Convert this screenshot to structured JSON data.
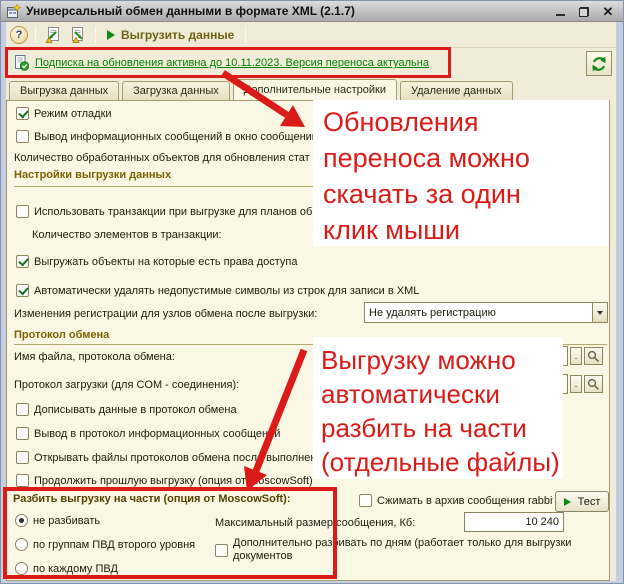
{
  "window": {
    "title": "Универсальный обмен данными в формате XML (2.1.7)"
  },
  "toolbar": {
    "help_glyph": "?",
    "run_label": "Выгрузить данные"
  },
  "banner": {
    "link_text": "Подписка на обновления активна до 10.11.2023. Версия переноса актуальна"
  },
  "tabs": {
    "items": [
      "Выгрузка данных",
      "Загрузка данных",
      "Дополнительные настройки",
      "Удаление данных"
    ],
    "active": "Дополнительные настройки"
  },
  "settings": {
    "debug_mode": "Режим отладки",
    "info_messages": "Вывод информационных сообщений в окно сообщений",
    "processed_count": "Количество обработанных объектов для обновления стат",
    "export_group_title": "Настройки выгрузки данных",
    "use_transactions": "Использовать транзакции при выгрузке для планов об",
    "transaction_items": "Количество элементов в транзакции:",
    "export_with_rights": "Выгружать объекты на которые есть права доступа",
    "auto_remove_invalid": "Автоматически удалять недопустимые символы из строк для записи в XML",
    "registration_label": "Изменения регистрации для узлов обмена после выгрузки:",
    "registration_value": "Не удалять регистрацию",
    "protocol_group_title": "Протокол обмена",
    "protocol_file_label": "Имя файла, протокола обмена:",
    "protocol_com_label": "Протокол загрузки (для COM - соединения):",
    "append_protocol": "Дописывать данные в протокол обмена",
    "protocol_info": "Вывод в протокол информационных сообщений",
    "open_protocol_files": "Открывать файлы протоколов обмена после выполнен",
    "continue_export": "Продолжить прошлую выгрузку (опция от MoscowSoft)",
    "mini_dot": "."
  },
  "checks": {
    "debug_mode": true,
    "info_messages": false,
    "use_transactions": false,
    "export_with_rights": true,
    "auto_remove_invalid": true,
    "append_protocol": false,
    "protocol_info": false,
    "open_protocol_files": false,
    "continue_export": false,
    "compress": false,
    "split_by_days": false
  },
  "split_section": {
    "title": "Разбить выгрузку на части (опция от MoscowSoft):",
    "radios": [
      {
        "label": "не разбивать",
        "selected": true
      },
      {
        "label": "по группам ПВД второго уровня",
        "selected": false
      },
      {
        "label": "по каждому ПВД",
        "selected": false
      }
    ],
    "compress_label": "Сжимать в архив сообщения rabbit M",
    "test_label": "Тест",
    "max_size_label": "Максимальный размер сообщения, Кб:",
    "max_size_value": "10 240",
    "split_by_days_label": "Дополнительно разбивать по дням (работает только для выгрузки документов"
  },
  "annotations": {
    "color": "#da1b17",
    "note1": [
      "Обновления",
      "переноса можно",
      "скачать за один",
      "клик мыши"
    ],
    "note2": [
      "Выгрузку можно",
      "автоматически",
      "разбить на части",
      "(отдельные файлы)"
    ]
  }
}
